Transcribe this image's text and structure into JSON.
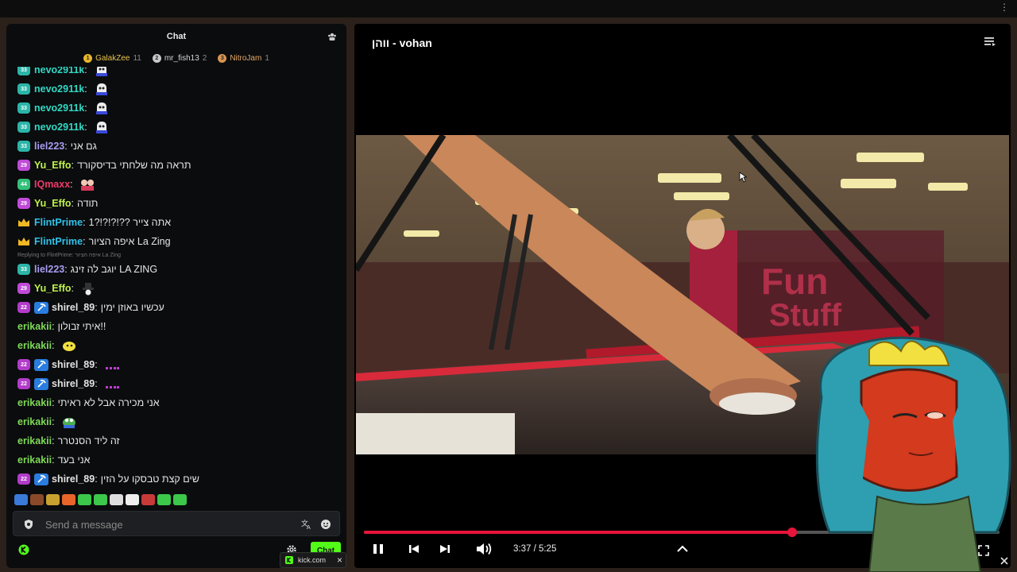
{
  "chat": {
    "title": "Chat",
    "leaderboard": [
      {
        "rank": "1",
        "name": "GalakZee",
        "count": "11",
        "color": "#e8c34a",
        "badge": "#e8b52a"
      },
      {
        "rank": "2",
        "name": "mr_fish13",
        "count": "2",
        "color": "#d6d6d6",
        "badge": "#c8c8c8"
      },
      {
        "rank": "3",
        "name": "NitroJam",
        "count": "1",
        "color": "#e3a868",
        "badge": "#d89550"
      }
    ],
    "messages": [
      {
        "badge": "33",
        "user": "nevo2911k",
        "sep": ":",
        "text": "",
        "color": "#30d9c4",
        "emote": "ghost"
      },
      {
        "badge": "33",
        "user": "nevo2911k",
        "sep": ":",
        "text": "",
        "color": "#30d9c4",
        "emote": "ghost"
      },
      {
        "badge": "33",
        "user": "nevo2911k",
        "sep": ":",
        "text": "",
        "color": "#30d9c4",
        "emote": "ghost"
      },
      {
        "badge": "33",
        "user": "nevo2911k",
        "sep": ":",
        "text": "",
        "color": "#30d9c4",
        "emote": "ghost"
      },
      {
        "badge": "33",
        "user": "liel223",
        "sep": ":",
        "text": "גם אני",
        "color": "#a89cf0"
      },
      {
        "badge": "29",
        "user": "Yu_Effo",
        "sep": ":",
        "text": "תראה מה שלחתי בדיסקורד",
        "color": "#bff24a"
      },
      {
        "badge": "44",
        "user": "IQmaxx",
        "sep": ":",
        "text": "",
        "color": "#ee3a6a",
        "emote": "duo"
      },
      {
        "badge": "29",
        "user": "Yu_Effo",
        "sep": ":",
        "text": "תודה",
        "color": "#bff24a"
      },
      {
        "badge": "crown",
        "user": "FlintPrime",
        "sep": ":",
        "text": "אתה צייר ??!?!?!?1",
        "color": "#31c2e8"
      },
      {
        "badge": "crown",
        "user": "FlintPrime",
        "sep": ":",
        "text": "איפה הציור La Zing",
        "color": "#31c2e8"
      },
      {
        "reply": "Replying to FlintPrime: איפה הציור La Zing"
      },
      {
        "badge": "33",
        "user": "liel223",
        "sep": ":",
        "text": "יוגב לה זינג LA ZING",
        "color": "#a89cf0"
      },
      {
        "badge": "29",
        "user": "Yu_Effo",
        "sep": ":",
        "text": "",
        "color": "#bff24a",
        "emote": "hat"
      },
      {
        "badge": "22",
        "pick": true,
        "user": "shirel_89",
        "sep": ":",
        "text": "עכשיו באוזן ימין",
        "color": "#e2e2e2"
      },
      {
        "user": "erikakii",
        "sep": ":",
        "text": "איתי זבולון!!",
        "color": "#7ed957"
      },
      {
        "user": "erikakii",
        "sep": ":",
        "text": "",
        "color": "#7ed957",
        "emote": "blob"
      },
      {
        "badge": "22",
        "pick": true,
        "user": "shirel_89",
        "sep": ":",
        "text": "",
        "color": "#e2e2e2",
        "emote": "dots"
      },
      {
        "badge": "22",
        "pick": true,
        "user": "shirel_89",
        "sep": ":",
        "text": "",
        "color": "#e2e2e2",
        "emote": "dots"
      },
      {
        "user": "erikakii",
        "sep": ":",
        "text": "אני מכירה אבל לא ראיתי",
        "color": "#7ed957"
      },
      {
        "user": "erikakii",
        "sep": ":",
        "text": "",
        "color": "#7ed957",
        "emote": "pepe"
      },
      {
        "user": "erikakii",
        "sep": ":",
        "text": "זה ליד הסנטרר",
        "color": "#7ed957"
      },
      {
        "user": "erikakii",
        "sep": ":",
        "text": "אני בעד",
        "color": "#7ed957"
      },
      {
        "badge": "22",
        "pick": true,
        "user": "shirel_89",
        "sep": ":",
        "text": "שים קצת טבסקו על הזין",
        "color": "#e2e2e2"
      }
    ],
    "input_placeholder": "Send a message",
    "send_label": "Chat",
    "popup_text": "kick.com",
    "popup_close": "×"
  },
  "player": {
    "title": "ווהן - vohan",
    "time": "3:37 / 5:25",
    "progress_fraction": 0.674,
    "accent": "#e8143a"
  },
  "icons": {
    "kick": "kick-logo-icon",
    "accent_green": "#53fc18"
  }
}
